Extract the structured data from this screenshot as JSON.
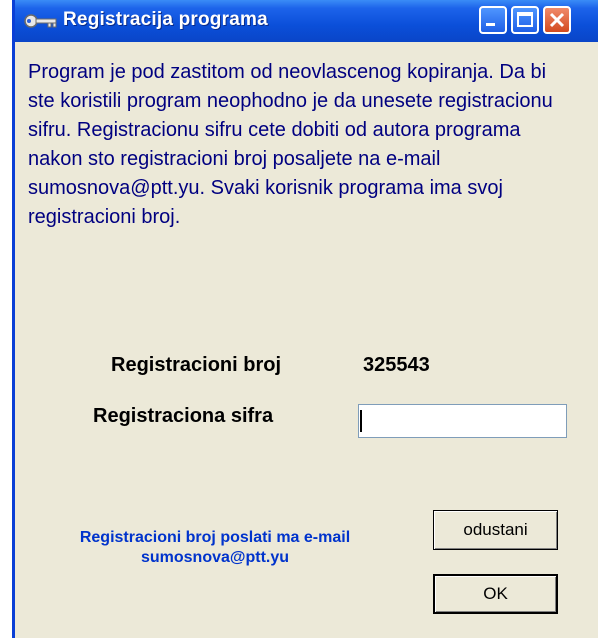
{
  "window": {
    "title": "Registracija programa",
    "icon": "key-icon"
  },
  "description": "Program je pod zastitom od neovlascenog kopiranja. Da bi ste koristili program neophodno je da unesete registracionu sifru. Registracionu sifru cete dobiti od autora programa nakon sto registracioni broj posaljete na e-mail sumosnova@ptt.yu. Svaki korisnik programa ima svoj registracioni broj.",
  "registration": {
    "number_label": "Registracioni broj",
    "number_value": "325543",
    "code_label": "Registraciona sifra",
    "code_value": ""
  },
  "note": {
    "line1": "Registracioni broj poslati ma e-mail",
    "line2": "sumosnova@ptt.yu"
  },
  "buttons": {
    "cancel": "odustani",
    "ok": "OK"
  },
  "colors": {
    "titlebar": "#0b4fd9",
    "description_text": "#000080",
    "note_text": "#0033cc",
    "window_bg": "#ece9d8"
  }
}
